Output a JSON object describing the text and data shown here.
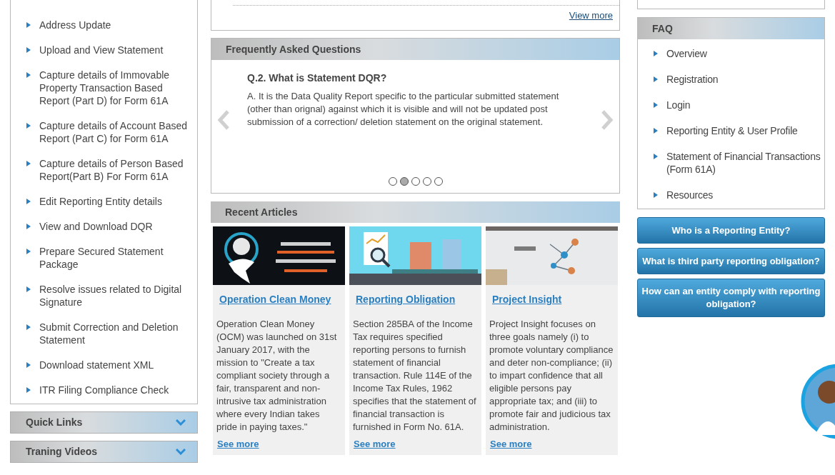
{
  "left_menu": {
    "items": [
      {
        "label": "Address Update"
      },
      {
        "label": "Upload and View Statement"
      },
      {
        "label": "Capture details of Immovable Property Transaction Based Report (Part D) for Form 61A"
      },
      {
        "label": "Capture details of Account Based Report (Part C) for Form 61A"
      },
      {
        "label": "Capture details of Person Based Report(Part B) For Form 61A"
      },
      {
        "label": "Edit Reporting Entity details"
      },
      {
        "label": "View and Download DQR"
      },
      {
        "label": "Prepare Secured Statement Package"
      },
      {
        "label": "Resolve issues related to Digital Signature"
      },
      {
        "label": "Submit Correction and Deletion Statement"
      },
      {
        "label": "Download statement XML"
      },
      {
        "label": "ITR Filing Compliance Check"
      }
    ]
  },
  "accordions": [
    {
      "title": "Quick Links",
      "expanded": false
    },
    {
      "title": "Traning Videos",
      "expanded": false
    }
  ],
  "top_card": {
    "link": "View more"
  },
  "faq_carousel": {
    "title": "Frequently Asked Questions",
    "question": "Q.2. What is Statement DQR?",
    "answer": "A. It is the Data Quality Report specific to the particular submitted statement (other than orignal) against which it is visible and will not be updated post submission of a correction/ deletion statement on the original statement.",
    "dots": [
      {
        "selected": false
      },
      {
        "selected": true
      },
      {
        "selected": false
      },
      {
        "selected": false
      },
      {
        "selected": false
      }
    ]
  },
  "recent_articles": {
    "title": "Recent Articles",
    "articles": [
      {
        "kind": "picture",
        "title": "Operation Clean Money",
        "text": "Operation Clean Money (OCM) was launched on 31st January 2017, with the mission to \"Create a tax compliant society through a fair, transparent and non-intrusive tax administration where every Indian takes pride in paying taxes.\"",
        "link": "See more"
      },
      {
        "kind": "picture",
        "title": "Reporting Obligation",
        "text": "Section 285BA of the Income Tax requires specified reporting persons to furnish statement of financial transaction. Rule 114E of the Income Tax Rules, 1962 specifies that the statement of financial transaction is furnished in Form No. 61A.",
        "link": "See more"
      },
      {
        "kind": "picture",
        "title": "Project Insight",
        "text": "Project Insight focuses on three goals namely (i) to promote voluntary compliance and deter non-compliance; (ii) to impart confidence that all eligible persons pay appropriate tax; and (iii) to promote fair and judicious tax administration.",
        "link": "See more"
      }
    ]
  },
  "faq_panel": {
    "title": "FAQ",
    "items": [
      {
        "label": "Overview"
      },
      {
        "label": "Registration"
      },
      {
        "label": "Login"
      },
      {
        "label": "Reporting Entity & User Profile"
      },
      {
        "label": "Statement of Financial Transactions (Form 61A)"
      },
      {
        "label": "Resources"
      }
    ]
  },
  "question_buttons": [
    "Who is a Reporting Entity?",
    "What is third party reporting obligation?",
    "How can an entity comply with reporting obligation?"
  ]
}
